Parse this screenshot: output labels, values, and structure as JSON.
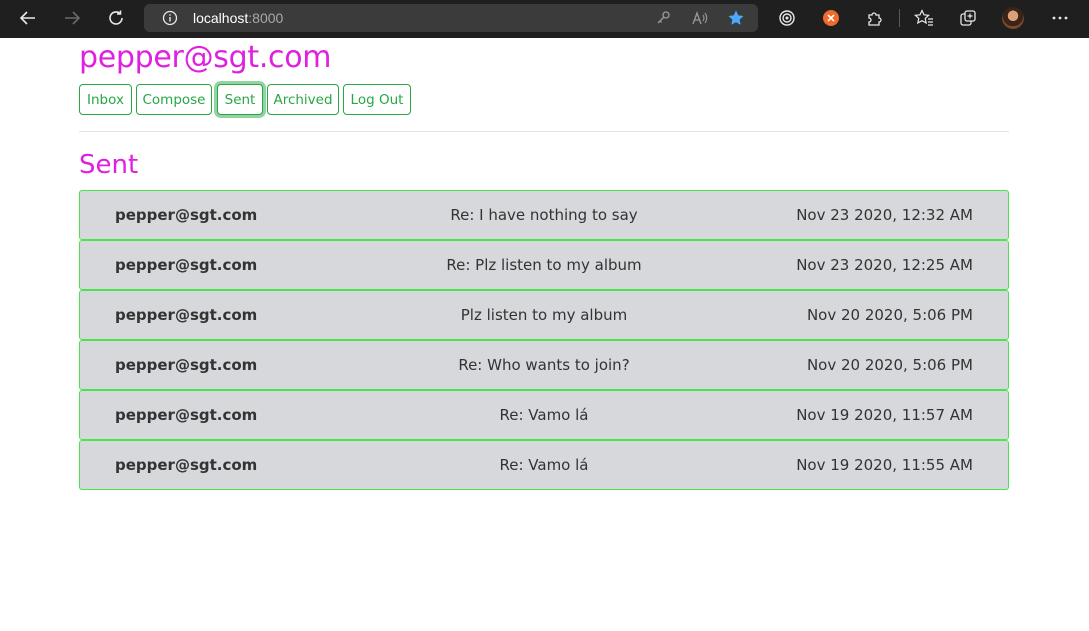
{
  "browser": {
    "url_host": "localhost",
    "url_port": ":8000",
    "icons": [
      "back-arrow-icon",
      "forward-arrow-icon",
      "refresh-icon",
      "info-icon",
      "key-icon",
      "read-aloud-icon",
      "favorite-star-icon",
      "tracking-icon",
      "extension-orange-icon",
      "puzzle-extensions-icon",
      "favorites-list-icon",
      "collections-icon",
      "profile-avatar",
      "more-options-icon"
    ]
  },
  "header": {
    "user_email": "pepper@sgt.com"
  },
  "nav": {
    "inbox": "Inbox",
    "compose": "Compose",
    "sent": "Sent",
    "archived": "Archived",
    "logout": "Log Out",
    "active": "Sent"
  },
  "mailbox": {
    "title": "Sent",
    "emails": [
      {
        "sender": "pepper@sgt.com",
        "subject": "Re: I have nothing to say",
        "timestamp": "Nov 23 2020, 12:32 AM"
      },
      {
        "sender": "pepper@sgt.com",
        "subject": "Re: Plz listen to my album",
        "timestamp": "Nov 23 2020, 12:25 AM"
      },
      {
        "sender": "pepper@sgt.com",
        "subject": "Plz listen to my album",
        "timestamp": "Nov 20 2020, 5:06 PM"
      },
      {
        "sender": "pepper@sgt.com",
        "subject": "Re: Who wants to join?",
        "timestamp": "Nov 20 2020, 5:06 PM"
      },
      {
        "sender": "pepper@sgt.com",
        "subject": "Re: Vamo lá",
        "timestamp": "Nov 19 2020, 11:57 AM"
      },
      {
        "sender": "pepper@sgt.com",
        "subject": "Re: Vamo lá",
        "timestamp": "Nov 19 2020, 11:55 AM"
      }
    ]
  },
  "colors": {
    "accent_magenta": "#e020e0",
    "button_green": "#28a745",
    "row_border": "#4be24b",
    "row_bg": "#d7d8dc"
  }
}
